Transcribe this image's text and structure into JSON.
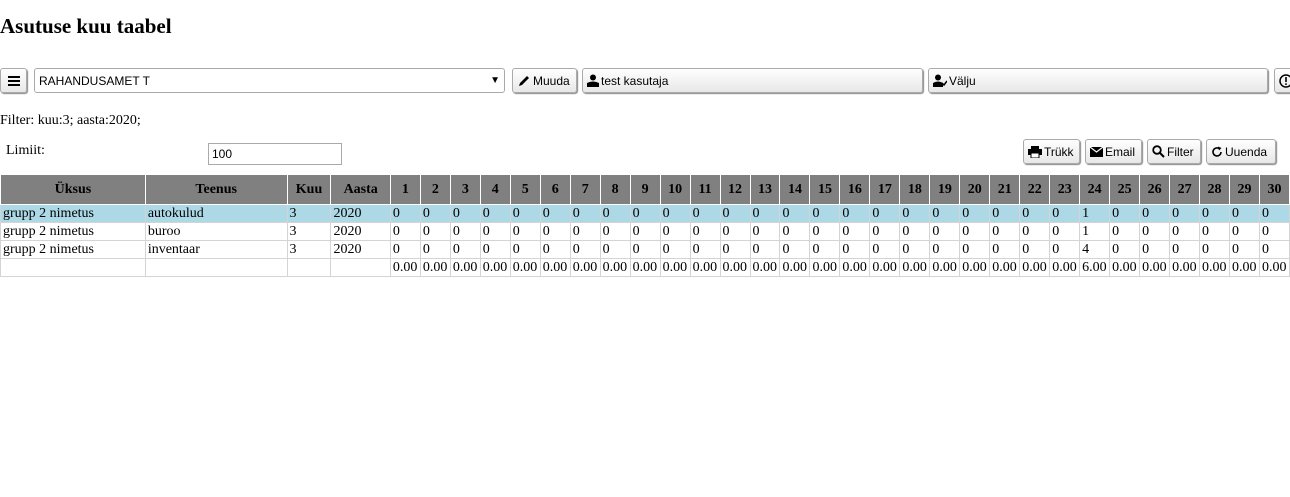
{
  "title": "Asutuse kuu taabel",
  "toolbar": {
    "org_select": "RAHANDUSAMET T",
    "edit_label": "Muuda",
    "user_label": "test kasutaja",
    "logout_label": "Välju"
  },
  "filter_text": "Filter: kuu:3; aasta:2020;",
  "limit": {
    "label": "Limiit:",
    "value": "100"
  },
  "actions": {
    "print": "Trükk",
    "email": "Email",
    "filter": "Filter",
    "refresh": "Uuenda"
  },
  "table": {
    "headers": [
      "Üksus",
      "Teenus",
      "Kuu",
      "Aasta",
      "1",
      "2",
      "3",
      "4",
      "5",
      "6",
      "7",
      "8",
      "9",
      "10",
      "11",
      "12",
      "13",
      "14",
      "15",
      "16",
      "17",
      "18",
      "19",
      "20",
      "21",
      "22",
      "23",
      "24",
      "25",
      "26",
      "27",
      "28",
      "29",
      "30"
    ],
    "rows": [
      [
        "grupp 2 nimetus",
        "autokulud",
        "3",
        "2020",
        "0",
        "0",
        "0",
        "0",
        "0",
        "0",
        "0",
        "0",
        "0",
        "0",
        "0",
        "0",
        "0",
        "0",
        "0",
        "0",
        "0",
        "0",
        "0",
        "0",
        "0",
        "0",
        "0",
        "1",
        "0",
        "0",
        "0",
        "0",
        "0",
        "0"
      ],
      [
        "grupp 2 nimetus",
        "buroo",
        "3",
        "2020",
        "0",
        "0",
        "0",
        "0",
        "0",
        "0",
        "0",
        "0",
        "0",
        "0",
        "0",
        "0",
        "0",
        "0",
        "0",
        "0",
        "0",
        "0",
        "0",
        "0",
        "0",
        "0",
        "0",
        "1",
        "0",
        "0",
        "0",
        "0",
        "0",
        "0"
      ],
      [
        "grupp 2 nimetus",
        "inventaar",
        "3",
        "2020",
        "0",
        "0",
        "0",
        "0",
        "0",
        "0",
        "0",
        "0",
        "0",
        "0",
        "0",
        "0",
        "0",
        "0",
        "0",
        "0",
        "0",
        "0",
        "0",
        "0",
        "0",
        "0",
        "0",
        "4",
        "0",
        "0",
        "0",
        "0",
        "0",
        "0"
      ]
    ],
    "totals": [
      "",
      "",
      "",
      "",
      "0.00",
      "0.00",
      "0.00",
      "0.00",
      "0.00",
      "0.00",
      "0.00",
      "0.00",
      "0.00",
      "0.00",
      "0.00",
      "0.00",
      "0.00",
      "0.00",
      "0.00",
      "0.00",
      "0.00",
      "0.00",
      "0.00",
      "0.00",
      "0.00",
      "0.00",
      "0.00",
      "6.00",
      "0.00",
      "0.00",
      "0.00",
      "0.00",
      "0.00",
      "0.00"
    ],
    "selected_row": 0
  },
  "colors": {
    "header_bg": "#808080",
    "selected_row": "#add8e6"
  }
}
